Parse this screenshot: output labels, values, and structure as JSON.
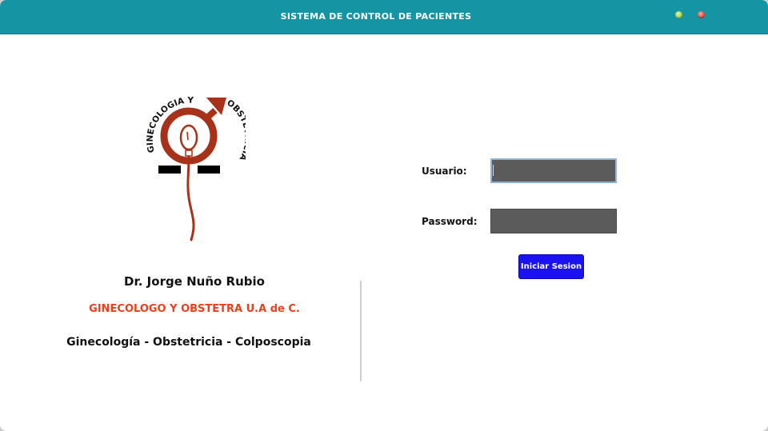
{
  "window": {
    "title": "SISTEMA DE CONTROL DE PACIENTES"
  },
  "logo": {
    "arc_text_left": "GINECOLOGIA Y",
    "arc_text_right": "OBSTETRICIA",
    "brand_color": "#a83219"
  },
  "doctor": {
    "name": "Dr. Jorge Nuño Rubio",
    "specialty": "GINECOLOGO Y OBSTETRA U.A de C.",
    "services": "Ginecología - Obstetricia - Colposcopia"
  },
  "login": {
    "username_label": "Usuario:",
    "username_value": "",
    "password_label": "Password:",
    "password_value": "",
    "submit_label": "Iniciar Sesion"
  },
  "colors": {
    "titlebar": "#1594a4",
    "accent_text": "#e8401c",
    "button": "#1a12f0",
    "input_bg": "#5b5b5b"
  }
}
